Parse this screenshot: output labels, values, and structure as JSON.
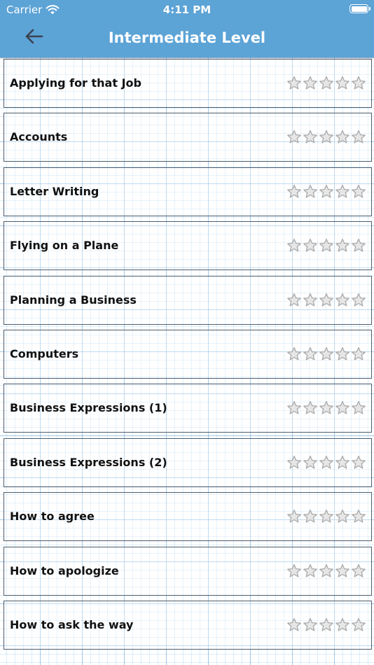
{
  "status_bar": {
    "carrier": "Carrier",
    "time": "4:11 PM",
    "wifi_icon": "wifi-icon",
    "battery_icon": "battery-icon"
  },
  "nav": {
    "back_icon": "arrow-left-icon",
    "title": "Intermediate Level"
  },
  "colors": {
    "header": "#5ca3d6",
    "row_border": "#4f5d6c",
    "grid": "#6eaadc",
    "star_fill": "#e6e6e6",
    "star_stroke": "#a9a9a9"
  },
  "lessons": [
    {
      "title": "Applying for that Job",
      "rating": 0,
      "max_rating": 5
    },
    {
      "title": "Accounts",
      "rating": 0,
      "max_rating": 5
    },
    {
      "title": "Letter Writing",
      "rating": 0,
      "max_rating": 5
    },
    {
      "title": "Flying on a Plane",
      "rating": 0,
      "max_rating": 5
    },
    {
      "title": "Planning a Business",
      "rating": 0,
      "max_rating": 5
    },
    {
      "title": "Computers",
      "rating": 0,
      "max_rating": 5
    },
    {
      "title": "Business Expressions (1)",
      "rating": 0,
      "max_rating": 5
    },
    {
      "title": "Business Expressions (2)",
      "rating": 0,
      "max_rating": 5
    },
    {
      "title": "How to agree",
      "rating": 0,
      "max_rating": 5
    },
    {
      "title": "How to apologize",
      "rating": 0,
      "max_rating": 5
    },
    {
      "title": "How to ask the way",
      "rating": 0,
      "max_rating": 5
    }
  ]
}
